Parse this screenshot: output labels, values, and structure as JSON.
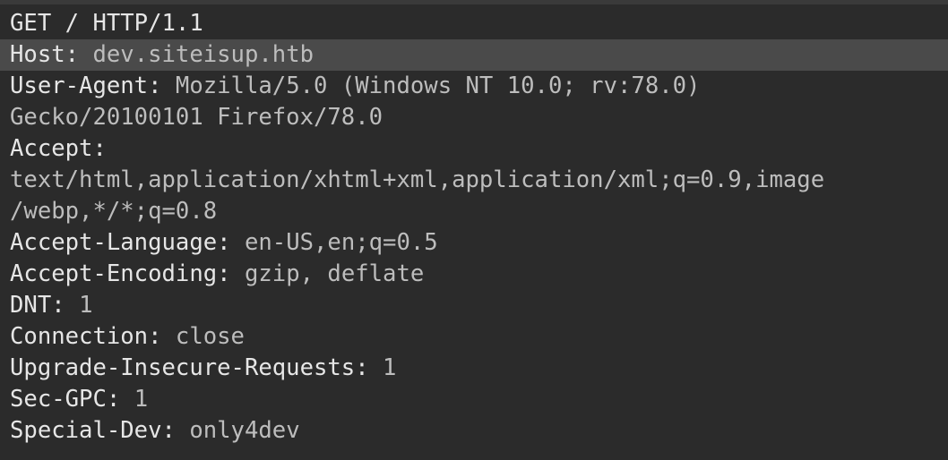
{
  "request": {
    "request_line": "GET / HTTP/1.1",
    "lines": [
      {
        "key": "Host",
        "sep": ": ",
        "value": "dev.siteisup.htb",
        "highlighted": true
      },
      {
        "key": "User-Agent",
        "sep": ": ",
        "value": "Mozilla/5.0 (Windows NT 10.0; rv:78.0)"
      },
      {
        "key": "",
        "sep": "",
        "value": "Gecko/20100101 Firefox/78.0"
      },
      {
        "key": "Accept",
        "sep": ":",
        "value": ""
      },
      {
        "key": "",
        "sep": "",
        "value": "text/html,application/xhtml+xml,application/xml;q=0.9,image"
      },
      {
        "key": "",
        "sep": "",
        "value": "/webp,*/*;q=0.8"
      },
      {
        "key": "Accept-Language",
        "sep": ": ",
        "value": "en-US,en;q=0.5"
      },
      {
        "key": "Accept-Encoding",
        "sep": ": ",
        "value": "gzip, deflate"
      },
      {
        "key": "DNT",
        "sep": ": ",
        "value": "1"
      },
      {
        "key": "Connection",
        "sep": ": ",
        "value": "close"
      },
      {
        "key": "Upgrade-Insecure-Requests",
        "sep": ": ",
        "value": "1"
      },
      {
        "key": "Sec-GPC",
        "sep": ": ",
        "value": "1"
      },
      {
        "key": "Special-Dev",
        "sep": ": ",
        "value": "only4dev"
      }
    ]
  },
  "colors": {
    "background": "#2b2b2b",
    "highlight": "#4a4a4a",
    "key": "#e6e6e6",
    "value": "#bdbdbd"
  }
}
